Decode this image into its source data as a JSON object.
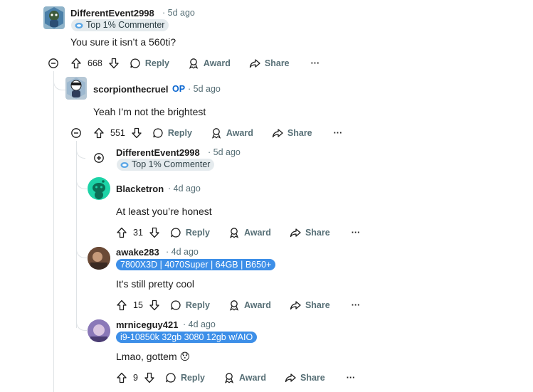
{
  "colors": {
    "thread_line": "#dfe3e6",
    "op_badge": "#0a66d0",
    "flair_blue": "#3d8fe8",
    "flair_gray": "#e5ebee",
    "meta_text": "#576f76"
  },
  "comments": [
    {
      "username": "DifferentEvent2998",
      "time": "5d ago",
      "flair": "Top 1% Commenter",
      "body": "You sure it isn’t a 560ti?",
      "votes": "668",
      "reply": "Reply",
      "award": "Award",
      "share": "Share",
      "more": "···"
    },
    {
      "username": "scorpionthecruel",
      "op": "OP",
      "time": "5d ago",
      "body": "Yeah I’m not the brightest",
      "votes": "551",
      "reply": "Reply",
      "award": "Award",
      "share": "Share",
      "more": "···"
    },
    {
      "username": "DifferentEvent2998",
      "time": "5d ago",
      "flair": "Top 1% Commenter",
      "collapsed": true
    },
    {
      "username": "Blacketron",
      "time": "4d ago",
      "body": "At least you’re honest",
      "votes": "31",
      "reply": "Reply",
      "award": "Award",
      "share": "Share",
      "more": "···"
    },
    {
      "username": "awake283",
      "time": "4d ago",
      "flair": "7800X3D | 4070Super | 64GB | B650+",
      "body": "It's still pretty cool",
      "votes": "15",
      "reply": "Reply",
      "award": "Award",
      "share": "Share",
      "more": "···"
    },
    {
      "username": "mrniceguy421",
      "time": "4d ago",
      "flair": "i9-10850k 32gb 3080 12gb w/AIO",
      "body": "Lmao, gottem",
      "emoji": "😯",
      "votes": "9",
      "reply": "Reply",
      "award": "Award",
      "share": "Share",
      "more": "···"
    }
  ]
}
